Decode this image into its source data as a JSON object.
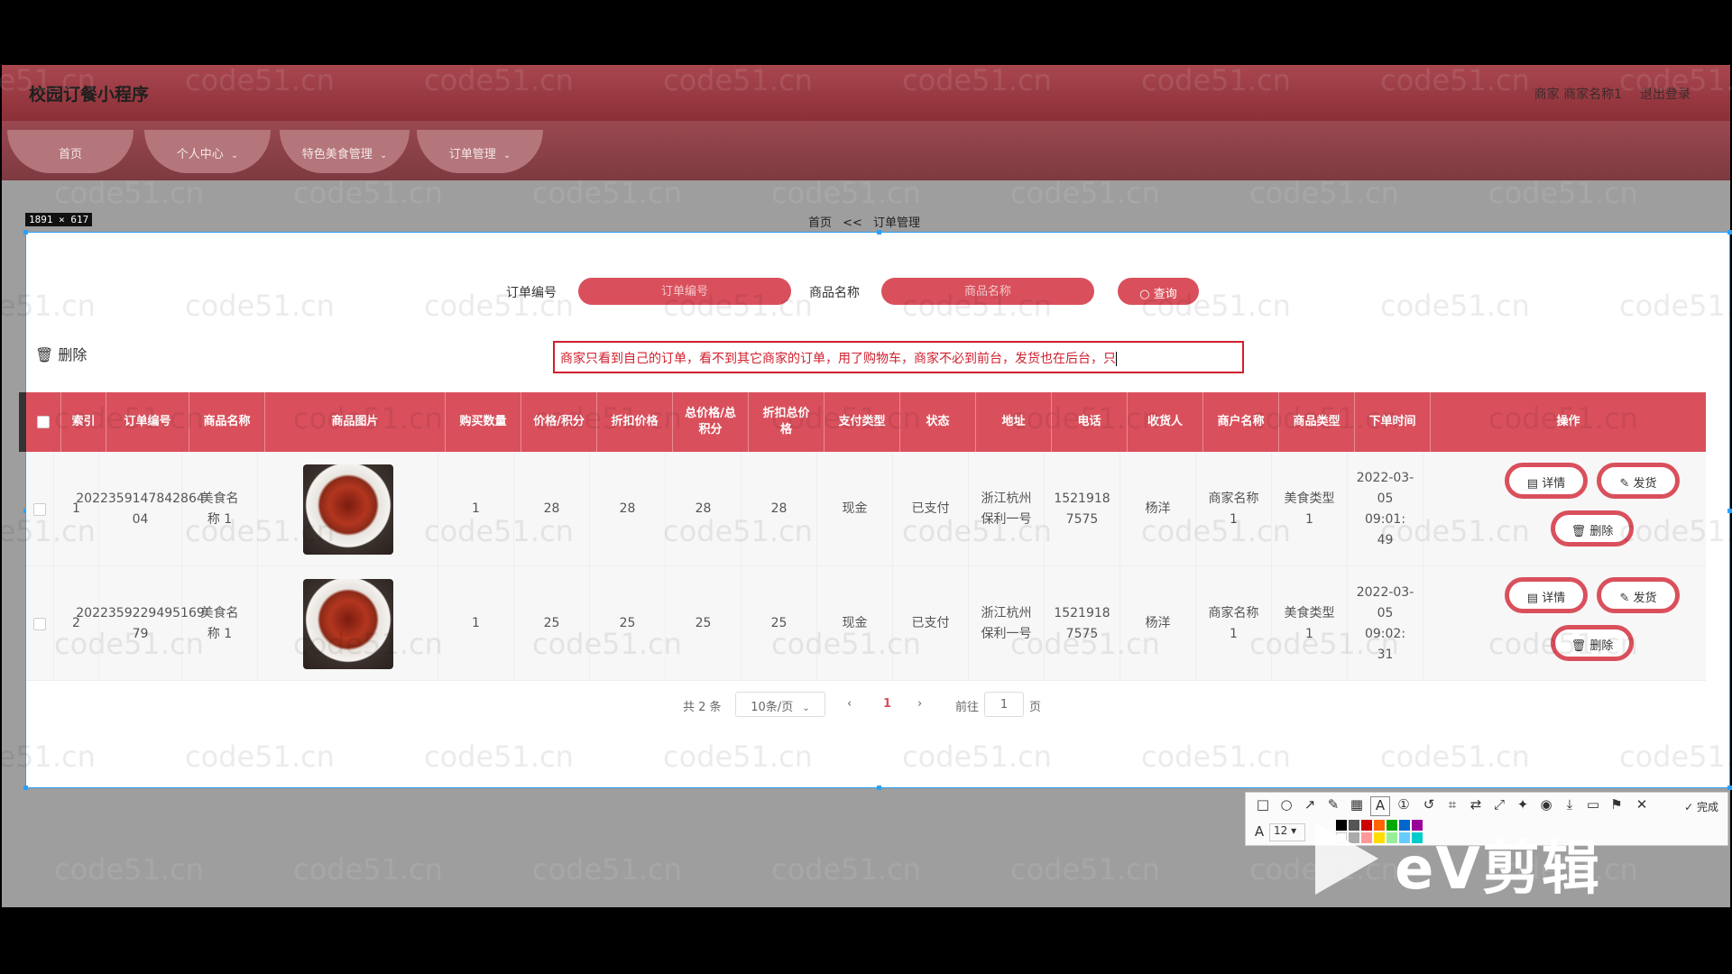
{
  "app": {
    "title": "校园订餐小程序",
    "user_info": "商家 商家名称1",
    "logout": "退出登录"
  },
  "nav": [
    {
      "label": "首页",
      "has_dropdown": false
    },
    {
      "label": "个人中心",
      "has_dropdown": true
    },
    {
      "label": "特色美食管理",
      "has_dropdown": true
    },
    {
      "label": "订单管理",
      "has_dropdown": true
    }
  ],
  "capture": {
    "size_label": "1891 × 617"
  },
  "breadcrumb": {
    "home": "首页",
    "separator": "<<",
    "current": "订单管理"
  },
  "search": {
    "order_no_label": "订单编号",
    "order_no_placeholder": "订单编号",
    "product_label": "商品名称",
    "product_placeholder": "商品名称",
    "query_button": "查询",
    "query_icon": "search-icon"
  },
  "actions": {
    "batch_delete": "删除",
    "batch_delete_icon": "trash-icon"
  },
  "annotation_text": "商家只看到自己的订单，看不到其它商家的订单，用了购物车，商家不必到前台，发货也在后台，只",
  "table": {
    "headers": {
      "index": "索引",
      "order_no": "订单编号",
      "product_name": "商品名称",
      "product_image": "商品图片",
      "quantity": "购买数量",
      "price": "价格/积分",
      "discount_price": "折扣价格",
      "total": "总价格/总积分",
      "discount_total": "折扣总价格",
      "pay_type": "支付类型",
      "status": "状态",
      "address": "地址",
      "phone": "电话",
      "receiver": "收货人",
      "merchant": "商户名称",
      "category": "商品类型",
      "order_time": "下单时间",
      "ops": "操作"
    },
    "rows": [
      {
        "index": "1",
        "order_no": "2022359147842864 04",
        "product_name": "美食名称 1",
        "quantity": "1",
        "price": "28",
        "discount_price": "28",
        "total": "28",
        "discount_total": "28",
        "pay_type": "现金",
        "status": "已支付",
        "address": "浙江杭州 保利一号",
        "phone": "1521918 7575",
        "receiver": "杨洋",
        "merchant": "商家名称 1",
        "category": "美食类型 1",
        "order_time": "2022-03- 05 09:01: 49"
      },
      {
        "index": "2",
        "order_no": "2022359229495169 79",
        "product_name": "美食名称 1",
        "quantity": "1",
        "price": "25",
        "discount_price": "25",
        "total": "25",
        "discount_total": "25",
        "pay_type": "现金",
        "status": "已支付",
        "address": "浙江杭州 保利一号",
        "phone": "1521918 7575",
        "receiver": "杨洋",
        "merchant": "商家名称 1",
        "category": "美食类型 1",
        "order_time": "2022-03- 05 09:02: 31"
      }
    ],
    "row_buttons": {
      "detail": "详情",
      "ship": "发货",
      "delete": "删除"
    }
  },
  "pager": {
    "total": "共 2 条",
    "page_size": "10条/页",
    "prev": "‹",
    "current_page": "1",
    "next": "›",
    "goto_label": "前往",
    "goto_value": "1",
    "page_suffix": "页"
  },
  "toolbar": {
    "font_size": "12",
    "done": "完成"
  },
  "watermark": "code51.cn",
  "overlay_logo": "eV剪辑",
  "colors": {
    "accent": "#d9505c",
    "header_bar": "#9a3c44"
  }
}
